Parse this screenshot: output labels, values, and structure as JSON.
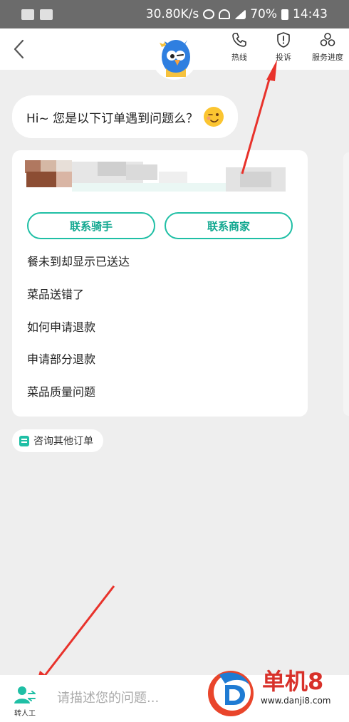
{
  "status_bar": {
    "speed": "30.80K/s",
    "battery": "70%",
    "time": "14:43"
  },
  "header": {
    "hotline_label": "热线",
    "complain_label": "投诉",
    "progress_label": "服务进度"
  },
  "chat": {
    "greeting": "Hi~ 您是以下订单遇到问题么？",
    "order_card": {
      "contact_rider": "联系骑手",
      "contact_merchant": "联系商家",
      "questions": [
        "餐未到却显示已送达",
        "菜品送错了",
        "如何申请退款",
        "申请部分退款",
        "菜品质量问题"
      ]
    },
    "other_orders": "咨询其他订单"
  },
  "bottom": {
    "human_agent_label": "转人工",
    "input_placeholder": "请描述您的问题..."
  },
  "watermark": {
    "title": "单机8",
    "url": "www.danji8.com"
  },
  "colors": {
    "accent": "#1fbfa5",
    "annotation_arrow": "#e8322b",
    "watermark_red": "#d8312a",
    "watermark_blue": "#1f7bd3"
  }
}
